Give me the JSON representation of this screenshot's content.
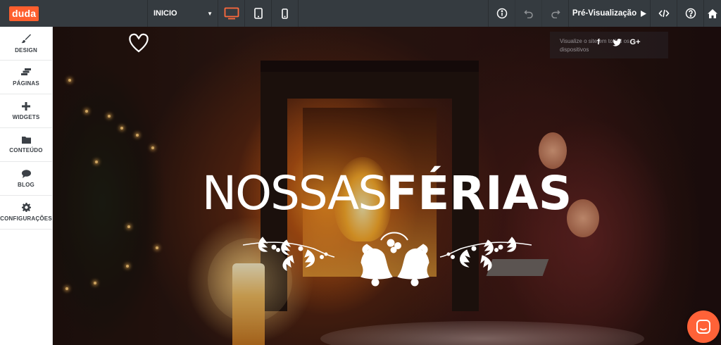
{
  "app": {
    "logo": "duda"
  },
  "topbar": {
    "page_select": "INICIO",
    "devices": [
      {
        "name": "desktop-icon",
        "active": true
      },
      {
        "name": "tablet-icon",
        "active": false
      },
      {
        "name": "mobile-icon",
        "active": false
      }
    ],
    "preview_label": "Pré-Visualização",
    "accent_color": "#ff6a3d"
  },
  "sidebar": {
    "items": [
      {
        "label": "DESIGN",
        "icon": "brush-icon"
      },
      {
        "label": "PÁGINAS",
        "icon": "pages-icon"
      },
      {
        "label": "WIDGETS",
        "icon": "plus-icon"
      },
      {
        "label": "CONTEÚDO",
        "icon": "folder-icon"
      },
      {
        "label": "BLOG",
        "icon": "speech-bubble-icon"
      },
      {
        "label": "CONFIGURAÇÕES",
        "icon": "gear-icon"
      }
    ]
  },
  "canvas": {
    "headline_light": "NOSSAS",
    "headline_bold": "FÉRIAS",
    "social_tooltip": "Visualize o site em todos os dispositivos",
    "social_icons": [
      "facebook-icon",
      "twitter-icon",
      "google-plus-icon"
    ]
  }
}
